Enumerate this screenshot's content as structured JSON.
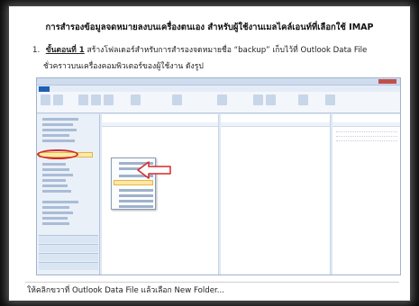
{
  "page": {
    "heading": "การสำรองข้อมูลจดหมายลงบนเครื่องตนเอง สำหรับผู้ใช้งานเมลไคล์เอนท์ที่เลือกใช้ IMAP",
    "step_number": "1.",
    "step_label": "ขั้นตอนที่ 1",
    "step_text": " สร้างโฟลเดอร์สำหรับการสำรองจดหมายชื่อ “backup” เก็บไว้ที่ Outlook Data File",
    "step_text_2": "ชั่วคราวบนเครื่องคอมพิวเตอร์ของผู้ใช้งาน ดังรูป",
    "caption": "ให้คลิกขวาที่ Outlook Data File แล้วเลือก New Folder..."
  },
  "screenshot": {
    "description": "Outlook 2010 window with context menu opened on Outlook Data File and New Folder highlighted",
    "highlight_color": "#d62828",
    "accent_color": "#1e5fb3"
  }
}
